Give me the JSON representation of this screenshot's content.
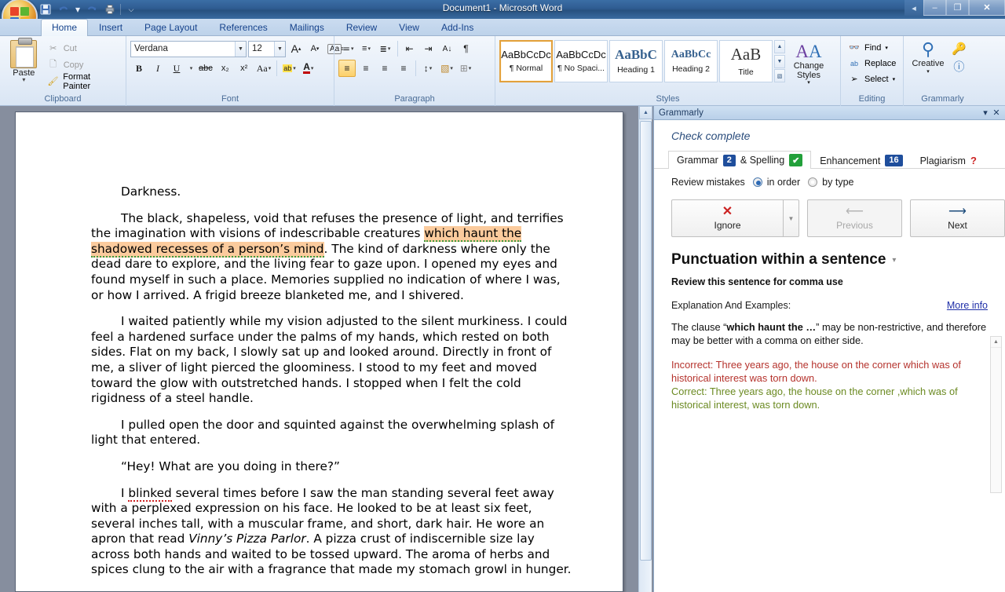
{
  "window": {
    "title": "Document1 - Microsoft Word",
    "quick_access": [
      {
        "name": "save",
        "glyph": "▣"
      },
      {
        "name": "undo",
        "glyph": "↶"
      },
      {
        "name": "undo-dropdown",
        "glyph": "▾"
      },
      {
        "name": "redo",
        "glyph": "↻"
      },
      {
        "name": "print-preview",
        "glyph": "⎙"
      },
      {
        "name": "customize",
        "glyph": "⌵"
      }
    ],
    "controls": {
      "back": "◂",
      "minimize": "–",
      "restore": "❐",
      "close": "✕"
    }
  },
  "ribbon": {
    "tabs": [
      {
        "label": "Home",
        "active": true
      },
      {
        "label": "Insert",
        "active": false
      },
      {
        "label": "Page Layout",
        "active": false
      },
      {
        "label": "References",
        "active": false
      },
      {
        "label": "Mailings",
        "active": false
      },
      {
        "label": "Review",
        "active": false
      },
      {
        "label": "View",
        "active": false
      },
      {
        "label": "Add-Ins",
        "active": false
      }
    ],
    "clipboard": {
      "group_label": "Clipboard",
      "paste_label": "Paste",
      "cut_label": "Cut",
      "copy_label": "Copy",
      "format_painter_label": "Format Painter"
    },
    "font": {
      "group_label": "Font",
      "font_name": "Verdana",
      "font_size": "12",
      "grow_font": "A",
      "shrink_font": "A",
      "clear_formatting": "Aa",
      "bold": "B",
      "italic": "I",
      "underline": "U",
      "strikethrough": "abc",
      "subscript": "x₂",
      "superscript": "x²",
      "change_case": "Aa",
      "highlight": "ab",
      "font_color": "A"
    },
    "paragraph": {
      "group_label": "Paragraph",
      "bullets": "≔",
      "numbering": "≡",
      "multilevel": "≣",
      "decrease_indent": "⇤",
      "increase_indent": "⇥",
      "sort": "A↓",
      "show_marks": "¶",
      "align_left": "≡",
      "align_center": "≡",
      "align_right": "≡",
      "justify": "≡",
      "line_spacing": "↕",
      "shading": "▧",
      "borders": "⊞"
    },
    "styles": {
      "group_label": "Styles",
      "items": [
        {
          "preview": "AaBbCcDc",
          "name": "¶ Normal",
          "selected": true,
          "kind": "plain"
        },
        {
          "preview": "AaBbCcDc",
          "name": "¶ No Spaci...",
          "selected": false,
          "kind": "plain"
        },
        {
          "preview": "AaBbC",
          "name": "Heading 1",
          "selected": false,
          "kind": "blue"
        },
        {
          "preview": "AaBbCc",
          "name": "Heading 2",
          "selected": false,
          "kind": "blue"
        },
        {
          "preview": "AaB",
          "name": "Title",
          "selected": false,
          "kind": "title"
        }
      ],
      "change_styles_label": "Change Styles"
    },
    "editing": {
      "group_label": "Editing",
      "find_label": "Find",
      "replace_label": "Replace",
      "select_label": "Select"
    },
    "grammarly_group": {
      "group_label": "Grammarly",
      "creative_label": "Creative",
      "key_icon": "key-icon",
      "info_icon": "info-icon"
    }
  },
  "document": {
    "paragraphs": [
      {
        "id": "p1",
        "runs": [
          {
            "text": "Darkness.",
            "style": "plain"
          }
        ]
      },
      {
        "id": "p2",
        "runs": [
          {
            "text": "The black, shapeless, void that refuses the presence of light, and terrifies the imagination with visions of indescribable creatures ",
            "style": "plain"
          },
          {
            "text": "which haunt the shadowed recesses of a person’s mind",
            "style": "highlight-green-underline"
          },
          {
            "text": ". The kind of darkness where only the dead dare to explore, and the living fear to gaze upon. I opened my eyes and found myself in such a place. Memories supplied no indication of where I was, or how I arrived. A frigid breeze blanketed me, and I shivered.",
            "style": "plain"
          }
        ]
      },
      {
        "id": "p3",
        "runs": [
          {
            "text": "I waited patiently while my vision adjusted to the silent murkiness. I could feel a hardened surface under the palms of my hands, which rested on both sides. Flat on my back, I slowly sat up and looked around. Directly in front of me, a sliver of light pierced the gloominess. I stood to my feet and moved toward the glow with outstretched hands. I stopped when I felt the cold rigidness of a steel handle.",
            "style": "plain"
          }
        ]
      },
      {
        "id": "p4",
        "runs": [
          {
            "text": "I pulled open the door and squinted against the overwhelming splash of light that entered.",
            "style": "plain"
          }
        ]
      },
      {
        "id": "p5",
        "runs": [
          {
            "text": "“Hey! What are you doing in there?”",
            "style": "plain"
          }
        ]
      },
      {
        "id": "p6",
        "runs": [
          {
            "text": "I ",
            "style": "plain"
          },
          {
            "text": "blinked",
            "style": "red-underline"
          },
          {
            "text": " several times before I saw the man standing several feet away with a perplexed expression on his face. He looked to be at least six feet, several inches tall, with a muscular frame, and short, dark hair. He wore an apron that read ",
            "style": "plain"
          },
          {
            "text": "Vinny’s Pizza Parlor",
            "style": "italic"
          },
          {
            "text": ". A pizza crust of indiscernible size lay across both hands and waited to be tossed upward. The aroma of herbs and spices clung to the air with a fragrance that made my stomach growl in hunger.",
            "style": "plain"
          }
        ]
      }
    ]
  },
  "grammarly_panel": {
    "title": "Grammarly",
    "minimize_glyph": "▾",
    "close_glyph": "✕",
    "status": "Check complete",
    "tabs": [
      {
        "label_before": "Grammar",
        "badge": "2",
        "label_after": "& Spelling",
        "check": "✔",
        "active": true
      },
      {
        "label_before": "Enhancement",
        "badge": "16",
        "label_after": "",
        "check": "",
        "active": false
      },
      {
        "label_before": "Plagiarism",
        "badge": "",
        "label_after": "",
        "check": "?",
        "active": false
      }
    ],
    "review_label": "Review mistakes",
    "review_options": [
      {
        "label": "in order",
        "selected": true
      },
      {
        "label": "by type",
        "selected": false
      }
    ],
    "buttons": {
      "ignore": {
        "label": "Ignore",
        "icon": "✕",
        "disabled": false
      },
      "previous": {
        "label": "Previous",
        "icon": "⟵",
        "disabled": true
      },
      "next": {
        "label": "Next",
        "icon": "⟶",
        "disabled": false
      }
    },
    "issue": {
      "title": "Punctuation within a sentence",
      "dropdown_glyph": "▾",
      "subtitle": "Review this sentence for comma use",
      "explanation_label": "Explanation And Examples:",
      "more_info_label": "More info",
      "body_pre": "The clause “",
      "body_bold": "which haunt the …",
      "body_post": "” may be non-restrictive, and therefore may be better with a comma on either side.",
      "incorrect": "Incorrect: Three years ago, the house on the corner which was of historical interest was torn down.",
      "correct": "Correct: Three years ago, the house on the corner ,which was of historical interest, was torn down."
    }
  },
  "colors": {
    "highlight": "#fbcb9d",
    "badge_blue": "#1f4e9c",
    "check_green": "#22a03a",
    "incorrect_red": "#b5332d",
    "correct_green": "#6b8a22",
    "link_blue": "#1f2fa8"
  }
}
